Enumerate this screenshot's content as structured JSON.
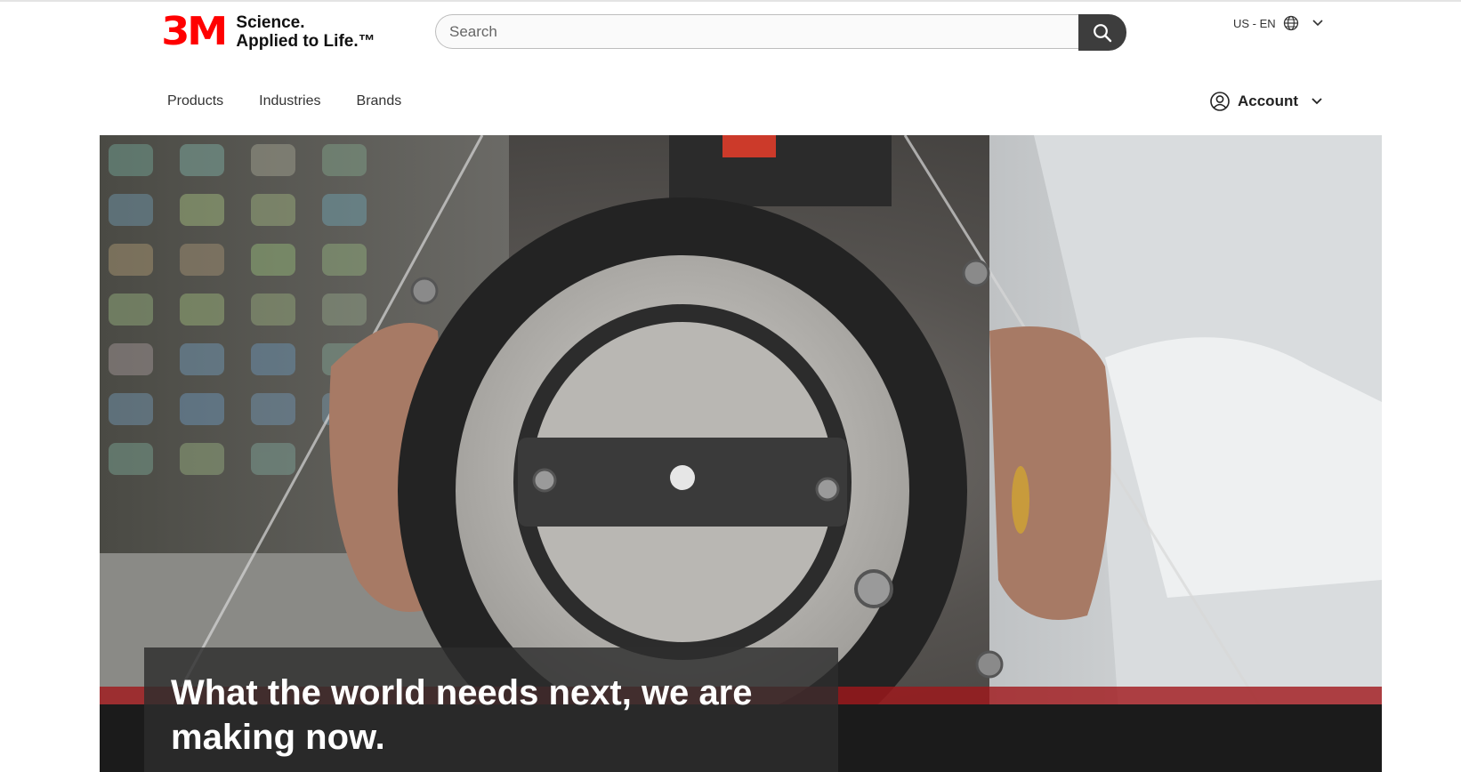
{
  "header": {
    "logo_mark": "3M",
    "tagline_line1": "Science.",
    "tagline_line2": "Applied to Life.™",
    "search": {
      "placeholder": "Search"
    },
    "locale": "US - EN"
  },
  "nav": {
    "items": [
      {
        "label": "Products"
      },
      {
        "label": "Industries"
      },
      {
        "label": "Brands"
      }
    ],
    "account_label": "Account"
  },
  "hero": {
    "headline": "What the world needs next, we are making now."
  },
  "colors": {
    "brand_red": "#ff0000",
    "search_button": "#3d3d3d",
    "caption_bg": "#2d2d2d"
  },
  "icons": [
    "search-icon",
    "globe-icon",
    "chevron-down-icon",
    "user-icon"
  ]
}
